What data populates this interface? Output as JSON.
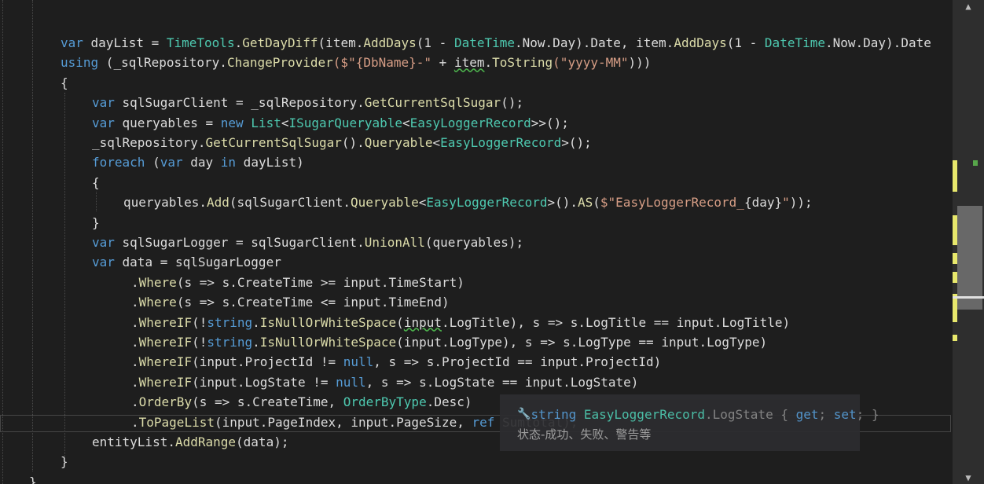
{
  "code_lines": [
    {
      "tokens": [
        {
          "t": "var",
          "c": "kw"
        },
        {
          "t": " dayList = "
        },
        {
          "t": "TimeTools",
          "c": "ty"
        },
        {
          "t": "."
        },
        {
          "t": "GetDayDiff",
          "c": "mt"
        },
        {
          "t": "(item."
        },
        {
          "t": "AddDays",
          "c": "mt"
        },
        {
          "t": "(1 - "
        },
        {
          "t": "DateTime",
          "c": "ty"
        },
        {
          "t": ".Now.Day).Date, item."
        },
        {
          "t": "AddDays",
          "c": "mt"
        },
        {
          "t": "(1 - "
        },
        {
          "t": "DateTime",
          "c": "ty"
        },
        {
          "t": ".Now.Day).Date"
        }
      ]
    },
    {
      "tokens": [
        {
          "t": "using",
          "c": "kw"
        },
        {
          "t": " (_sqlRepository."
        },
        {
          "t": "ChangeProvider",
          "c": "mt"
        },
        {
          "t": "($\"{DbName}-\"",
          "c": "str"
        },
        {
          "t": " + "
        },
        {
          "t": "item",
          "c": "sq"
        },
        {
          "t": "."
        },
        {
          "t": "ToString",
          "c": "mt"
        },
        {
          "t": "(\"yyyy-MM\"",
          "c": "str"
        },
        {
          "t": ")))"
        }
      ]
    },
    {
      "tokens": [
        {
          "t": "{"
        }
      ]
    },
    {
      "tokens": [
        {
          "t": "var",
          "c": "kw"
        },
        {
          "t": " sqlSugarClient = _sqlRepository."
        },
        {
          "t": "GetCurrentSqlSugar",
          "c": "mt"
        },
        {
          "t": "();"
        }
      ]
    },
    {
      "tokens": [
        {
          "t": "var",
          "c": "kw"
        },
        {
          "t": " queryables = "
        },
        {
          "t": "new",
          "c": "kw"
        },
        {
          "t": " "
        },
        {
          "t": "List",
          "c": "ty"
        },
        {
          "t": "<"
        },
        {
          "t": "ISugarQueryable",
          "c": "ty"
        },
        {
          "t": "<"
        },
        {
          "t": "EasyLoggerRecord",
          "c": "ty"
        },
        {
          "t": ">>();"
        }
      ]
    },
    {
      "tokens": [
        {
          "t": "_sqlRepository."
        },
        {
          "t": "GetCurrentSqlSugar",
          "c": "mt"
        },
        {
          "t": "()."
        },
        {
          "t": "Queryable",
          "c": "mt"
        },
        {
          "t": "<"
        },
        {
          "t": "EasyLoggerRecord",
          "c": "ty"
        },
        {
          "t": ">();"
        }
      ]
    },
    {
      "tokens": [
        {
          "t": "foreach",
          "c": "kw"
        },
        {
          "t": " ("
        },
        {
          "t": "var",
          "c": "kw"
        },
        {
          "t": " day "
        },
        {
          "t": "in",
          "c": "kw"
        },
        {
          "t": " dayList)"
        }
      ]
    },
    {
      "tokens": [
        {
          "t": "{"
        }
      ]
    },
    {
      "tokens": [
        {
          "t": "queryables."
        },
        {
          "t": "Add",
          "c": "mt"
        },
        {
          "t": "(sqlSugarClient."
        },
        {
          "t": "Queryable",
          "c": "mt"
        },
        {
          "t": "<"
        },
        {
          "t": "EasyLoggerRecord",
          "c": "ty"
        },
        {
          "t": ">()."
        },
        {
          "t": "AS",
          "c": "mt"
        },
        {
          "t": "("
        },
        {
          "t": "$\"EasyLoggerRecord_",
          "c": "str"
        },
        {
          "t": "{day}"
        },
        {
          "t": "\"",
          "c": "str"
        },
        {
          "t": "));"
        }
      ]
    },
    {
      "tokens": [
        {
          "t": "}"
        }
      ]
    },
    {
      "tokens": [
        {
          "t": "var",
          "c": "kw"
        },
        {
          "t": " sqlSugarLogger = sqlSugarClient."
        },
        {
          "t": "UnionAll",
          "c": "mt"
        },
        {
          "t": "(queryables);"
        }
      ]
    },
    {
      "tokens": [
        {
          "t": "var",
          "c": "kw"
        },
        {
          "t": " data = sqlSugarLogger"
        }
      ]
    },
    {
      "tokens": [
        {
          "t": "."
        },
        {
          "t": "Where",
          "c": "mt"
        },
        {
          "t": "(s => s.CreateTime >= input.TimeStart)"
        }
      ]
    },
    {
      "tokens": [
        {
          "t": "."
        },
        {
          "t": "Where",
          "c": "mt"
        },
        {
          "t": "(s => s.CreateTime <= input.TimeEnd)"
        }
      ]
    },
    {
      "tokens": [
        {
          "t": "."
        },
        {
          "t": "WhereIF",
          "c": "mt"
        },
        {
          "t": "(!"
        },
        {
          "t": "string",
          "c": "kw"
        },
        {
          "t": "."
        },
        {
          "t": "IsNullOrWhiteSpace",
          "c": "mt"
        },
        {
          "t": "("
        },
        {
          "t": "input",
          "c": "sq"
        },
        {
          "t": ".LogTitle), s => s.LogTitle == input.LogTitle)"
        }
      ]
    },
    {
      "tokens": [
        {
          "t": "."
        },
        {
          "t": "WhereIF",
          "c": "mt"
        },
        {
          "t": "(!"
        },
        {
          "t": "string",
          "c": "kw"
        },
        {
          "t": "."
        },
        {
          "t": "IsNullOrWhiteSpace",
          "c": "mt"
        },
        {
          "t": "(input.LogType), s => s.LogType == input.LogType)"
        }
      ]
    },
    {
      "tokens": [
        {
          "t": "."
        },
        {
          "t": "WhereIF",
          "c": "mt"
        },
        {
          "t": "(input.ProjectId != "
        },
        {
          "t": "null",
          "c": "kw"
        },
        {
          "t": ", s => s.ProjectId == input.ProjectId)"
        }
      ]
    },
    {
      "tokens": [
        {
          "t": "."
        },
        {
          "t": "WhereIF",
          "c": "mt"
        },
        {
          "t": "(input.LogState != "
        },
        {
          "t": "null",
          "c": "kw"
        },
        {
          "t": ", s => s.LogState == input.LogState)"
        }
      ]
    },
    {
      "tokens": [
        {
          "t": "."
        },
        {
          "t": "OrderBy",
          "c": "mt"
        },
        {
          "t": "(s => s.CreateTime, "
        },
        {
          "t": "OrderByType",
          "c": "ty"
        },
        {
          "t": ".Desc)"
        }
      ]
    },
    {
      "tokens": [
        {
          "t": "."
        },
        {
          "t": "ToPageList",
          "c": "mt"
        },
        {
          "t": "(input.PageIndex, input.PageSize, "
        },
        {
          "t": "ref",
          "c": "kw"
        },
        {
          "t": " Sumtotal);"
        }
      ]
    },
    {
      "tokens": [
        {
          "t": "entityList."
        },
        {
          "t": "AddRange",
          "c": "mt"
        },
        {
          "t": "(data);"
        }
      ]
    },
    {
      "tokens": [
        {
          "t": "}"
        }
      ]
    },
    {
      "tokens": [
        {
          "t": "}"
        }
      ]
    }
  ],
  "tooltip": {
    "icon": "wrench-icon",
    "signature": [
      {
        "t": "string",
        "c": "kw"
      },
      {
        "t": " "
      },
      {
        "t": "EasyLoggerRecord",
        "c": "ty"
      },
      {
        "t": ".LogState { "
      },
      {
        "t": "get",
        "c": "kw"
      },
      {
        "t": "; "
      },
      {
        "t": "set",
        "c": "kw"
      },
      {
        "t": "; }"
      }
    ],
    "description": "状态-成功、失败、警告等"
  },
  "scrollbar": {
    "up_arrow": "▲",
    "down_arrow": "▼",
    "thumb_position": 0.45
  },
  "colors": {
    "background": "#1e1e1e",
    "keyword": "#569cd6",
    "type": "#4ec9b0",
    "method": "#dcdcaa",
    "string": "#d69d85",
    "text": "#dcdcdc",
    "change_mark_yellow": "#e8e86c",
    "change_mark_green": "#57a64a"
  }
}
